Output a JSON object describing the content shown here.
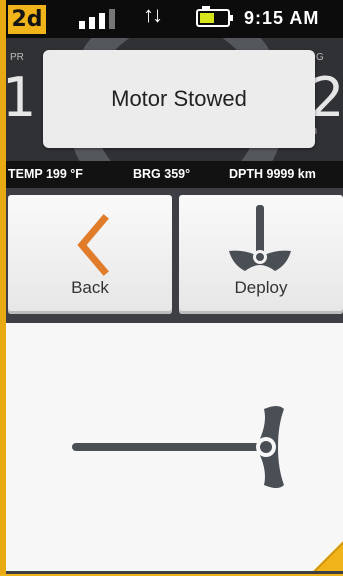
{
  "status_bar": {
    "mode_badge": "2d",
    "data_icon": "↑↓",
    "clock": "9:15 AM"
  },
  "background_gauge": {
    "left_label": "PR",
    "left_value": "1",
    "right_label": "G",
    "right_value": "2",
    "right_unit": "h"
  },
  "toast": {
    "message": "Motor Stowed"
  },
  "data_bar": {
    "temp": "TEMP 199 °F",
    "bearing": "BRG 359°",
    "depth": "DPTH 9999 km"
  },
  "buttons": {
    "back_label": "Back",
    "deploy_label": "Deploy"
  },
  "colors": {
    "accent": "#f0b41a",
    "back_chevron": "#e07c2a",
    "icon_gray": "#4a4e55",
    "battery_fill": "#d7e41c"
  },
  "icons": {
    "back": "chevron-left-icon",
    "deploy": "motor-deploy-icon",
    "stowed_motor": "motor-stowed-icon",
    "battery": "battery-icon",
    "signal": "signal-bars-icon"
  }
}
